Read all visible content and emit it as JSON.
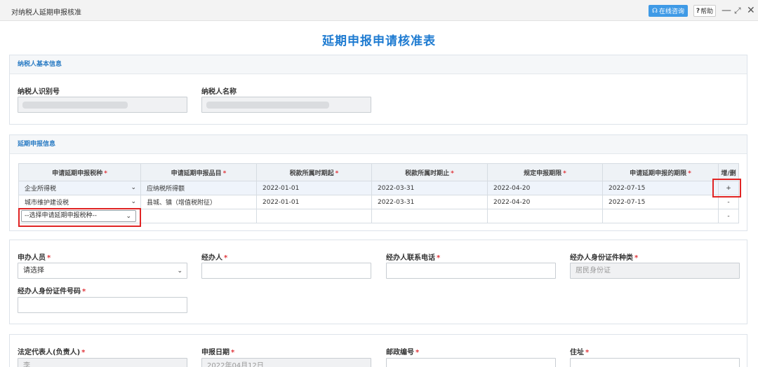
{
  "window": {
    "title": "对纳税人延期申报核准",
    "online_label": "在线咨询",
    "help_label": "帮助"
  },
  "form_title": "延期申报申请核准表",
  "basic": {
    "section_title": "纳税人基本信息",
    "taxpayer_id_label": "纳税人识别号",
    "taxpayer_name_label": "纳税人名称"
  },
  "delay": {
    "section_title": "延期申报信息",
    "headers": [
      "申请延期申报税种",
      "申请延期申报品目",
      "税款所属时期起",
      "税款所属时期止",
      "规定申报期限",
      "申请延期申报的期限",
      "增/删"
    ],
    "rows": [
      {
        "tax_type": "企业所得税",
        "item": "应纳税所得额",
        "start": "2022-01-01",
        "end": "2022-03-31",
        "deadline": "2022-04-20",
        "delay_to": "2022-07-15",
        "action": "+"
      },
      {
        "tax_type": "城市维护建设税",
        "item": "县城、镇（增值税附征）",
        "start": "2022-01-01",
        "end": "2022-03-31",
        "deadline": "2022-04-20",
        "delay_to": "2022-07-15",
        "action": "-"
      }
    ],
    "new_row": {
      "placeholder": "--选择申请延期申报税种--",
      "action": "-"
    }
  },
  "handler": {
    "applicant_label": "申办人员",
    "applicant_value": "请选择",
    "agent_label": "经办人",
    "agent_phone_label": "经办人联系电话",
    "agent_id_type_label": "经办人身份证件种类",
    "agent_id_type_value": "居民身份证",
    "agent_id_no_label": "经办人身份证件号码"
  },
  "legal": {
    "rep_label": "法定代表人(负责人)",
    "rep_value": "李",
    "date_label": "申报日期",
    "date_value": "2022年04月12日",
    "postcode_label": "邮政编号",
    "address_label": "住址"
  },
  "colors": {
    "accent": "#1e7bd1",
    "required": "#e0363b",
    "highlight_border": "#e02424"
  }
}
